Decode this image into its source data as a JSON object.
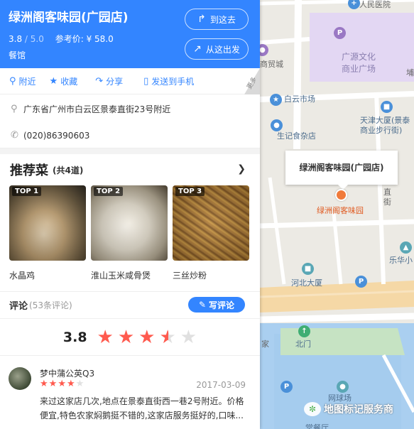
{
  "place": {
    "name": "绿洲阁客味园(广园店)",
    "rating": "3.8",
    "rating_max": "/ 5.0",
    "price_label": "参考价:",
    "price": "¥ 58.0",
    "category": "餐馆"
  },
  "header_buttons": {
    "go_here": "到这去",
    "start_here": "从这出发"
  },
  "actions": {
    "nearby": "附近",
    "collect": "收藏",
    "share": "分享",
    "send_phone": "发送到手机",
    "more": "更多"
  },
  "info": {
    "address": "广东省广州市白云区景泰直街23号附近",
    "phone": "(020)86390603"
  },
  "recommend": {
    "title": "推荐菜",
    "count": "(共4道)",
    "dishes": [
      {
        "badge": "TOP 1",
        "name": "水晶鸡"
      },
      {
        "badge": "TOP 2",
        "name": "淮山玉米咸骨煲"
      },
      {
        "badge": "TOP 3",
        "name": "三丝炒粉"
      }
    ]
  },
  "reviews": {
    "title": "评论",
    "count": "(53条评论)",
    "write_label": "写评论",
    "score": "3.8",
    "score_value": 3.8,
    "items": [
      {
        "user": "梦中蒲公英Q3",
        "stars": 4,
        "date": "2017-03-09",
        "text": "来过这家店几次,地点在景泰直街西一巷2号附近。价格便宜,特色农家焖鹅挺不错的,这家店服务挺好的,口味..."
      }
    ]
  },
  "map": {
    "callout": "绿洲阁客味园(广园店)",
    "marker_label": "绿洲阁客味园",
    "labels": {
      "hospital": "人民医院",
      "square": "广源文化商业广场",
      "trade_city": "商贸城",
      "baiyun_market": "白云市场",
      "tianjin": "天津大厦(景泰商业步行街)",
      "shengji": "生记食杂店",
      "jingtai": "直街",
      "lezhong": "乐华小",
      "hebei": "河北大厦",
      "beimen": "北门",
      "wangqiu": "网球场",
      "jia": "家",
      "tang": "堂餐厅",
      "pu": "埔"
    }
  },
  "watermark": "地图标记服务商",
  "colors": {
    "brand_blue": "#3385ff",
    "star_red": "#ff5a4e",
    "marker_orange": "#f07a3a"
  }
}
